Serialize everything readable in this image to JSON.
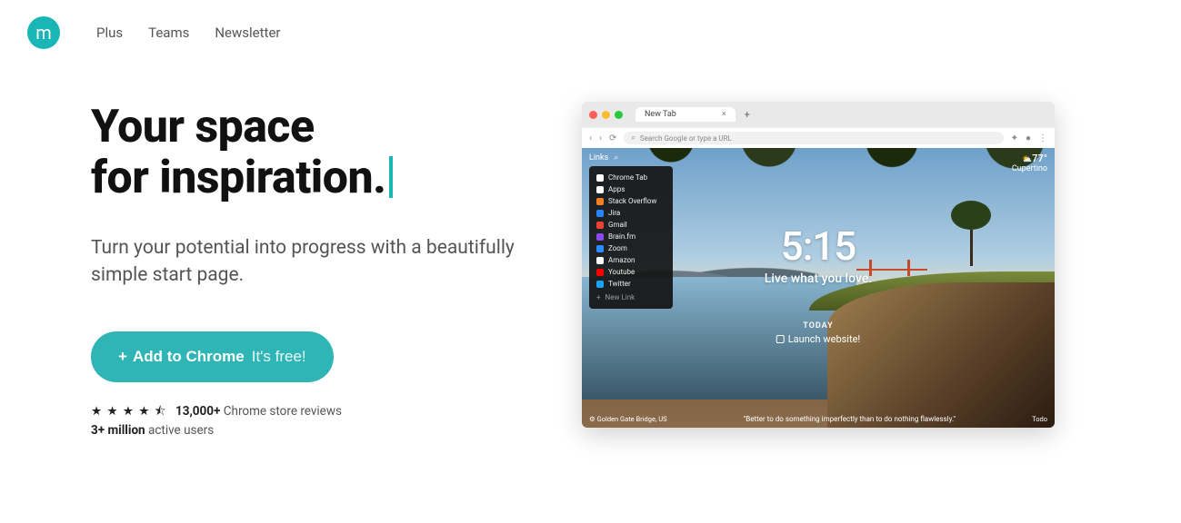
{
  "nav": {
    "logo_letter": "m",
    "items": [
      "Plus",
      "Teams",
      "Newsletter"
    ]
  },
  "hero": {
    "title_line1": "Your space",
    "title_line2": "for inspiration.",
    "subtitle": "Turn your potential into progress with a beautifully simple start page.",
    "cta_label": "Add to Chrome",
    "cta_free": "It's free!",
    "stars": "★ ★ ★ ★ ⯪",
    "reviews_count": "13,000+",
    "reviews_label": "Chrome store reviews",
    "users_count": "3+ million",
    "users_label": "active users"
  },
  "mock": {
    "tab_title": "New Tab",
    "addr_placeholder": "Search Google or type a URL",
    "links_label": "Links",
    "weather": {
      "temp": "77°",
      "location": "Cupertino"
    },
    "dropdown": [
      {
        "label": "Chrome Tab",
        "color": "#fff"
      },
      {
        "label": "Apps",
        "color": "#fff"
      },
      {
        "label": "Stack Overflow",
        "color": "#f48024"
      },
      {
        "label": "Jira",
        "color": "#2684ff"
      },
      {
        "label": "Gmail",
        "color": "#ea4335"
      },
      {
        "label": "Brain.fm",
        "color": "#8a4af0"
      },
      {
        "label": "Zoom",
        "color": "#2d8cff"
      },
      {
        "label": "Amazon",
        "color": "#fff"
      },
      {
        "label": "Youtube",
        "color": "#ff0000"
      },
      {
        "label": "Twitter",
        "color": "#1da1f2"
      }
    ],
    "dropdown_new": "New Link",
    "time": "5:15",
    "mantra": "Live what you love.",
    "today_label": "TODAY",
    "today_task": "Launch website!",
    "photo_credit": "Golden Gate Bridge, US",
    "quote": "\"Better to do something imperfectly than to do nothing flawlessly.\"",
    "todo_label": "Todo"
  }
}
